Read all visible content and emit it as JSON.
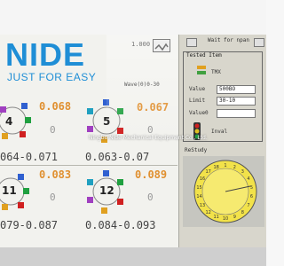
{
  "brand": {
    "logo": "NIDE",
    "tagline": "JUST FOR EASY"
  },
  "header": {
    "top_value": "1.000",
    "wait_label": "Wait for npan"
  },
  "wave": {
    "label": "Wave(0)0-30"
  },
  "tested": {
    "title": "Tested Item",
    "item_label": "TMX",
    "value_label": "Value",
    "value": "500BO",
    "limit_label": "Limit",
    "limit": "30-10",
    "valued_label": "Value0",
    "valued": "",
    "inval_label": "Inval"
  },
  "study": {
    "title": "ReStudy"
  },
  "stations": [
    {
      "number": "4",
      "top": "0.068",
      "bottom": "0",
      "range": "064-0.071"
    },
    {
      "number": "5",
      "top": "0.067",
      "bottom": "0",
      "range": "0.063-0.07"
    },
    {
      "number": "11",
      "top": "0.083",
      "bottom": "0",
      "range": "079-0.087"
    },
    {
      "number": "12",
      "top": "0.089",
      "bottom": "0",
      "range": "0.084-0.093"
    }
  ],
  "clock": {
    "numbers": [
      "1",
      "2",
      "3",
      "4",
      "5",
      "6",
      "7",
      "8",
      "9",
      "10",
      "11",
      "12",
      "13",
      "14",
      "15",
      "16",
      "17",
      "18"
    ]
  },
  "watermark": "Ningbo Nide Mechanical Equipment Co., Ltd.",
  "colors": {
    "brand_blue": "#1f8ed6",
    "stat_orange": "#e09030",
    "clock_yellow": "#f2e24a",
    "traffic_red": "#d02020",
    "traffic_green": "#20a040"
  }
}
